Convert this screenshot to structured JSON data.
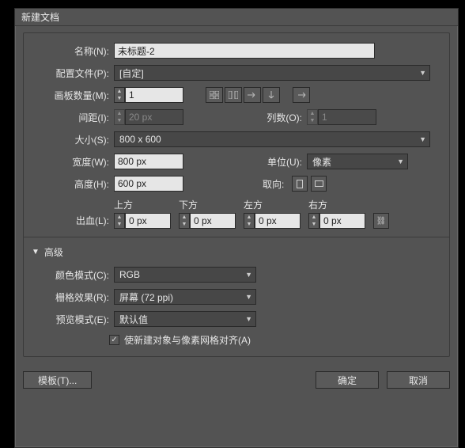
{
  "title": "新建文档",
  "labels": {
    "name": "名称(N):",
    "profile": "配置文件(P):",
    "artboards": "画板数量(M):",
    "spacing": "间距(I):",
    "columns": "列数(O):",
    "size": "大小(S):",
    "width": "宽度(W):",
    "unit": "单位(U):",
    "height": "高度(H):",
    "orientation": "取向:",
    "bleed": "出血(L):",
    "top": "上方",
    "bottom": "下方",
    "left": "左方",
    "right": "右方",
    "advanced": "高级",
    "colorMode": "颜色模式(C):",
    "rasterEffects": "栅格效果(R):",
    "previewMode": "预览模式(E):",
    "alignPixel": "使新建对象与像素网格对齐(A)"
  },
  "values": {
    "name": "未标题-2",
    "profile": "[自定]",
    "artboards": "1",
    "spacing": "20 px",
    "columns": "1",
    "size": "800 x 600",
    "width": "800 px",
    "unit": "像素",
    "height": "600 px",
    "bleedTop": "0 px",
    "bleedBottom": "0 px",
    "bleedLeft": "0 px",
    "bleedRight": "0 px",
    "colorMode": "RGB",
    "rasterEffects": "屏幕 (72 ppi)",
    "previewMode": "默认值",
    "alignPixel": true
  },
  "buttons": {
    "templates": "模板(T)...",
    "ok": "确定",
    "cancel": "取消"
  }
}
